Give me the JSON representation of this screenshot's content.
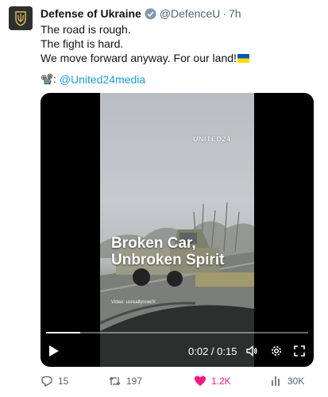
{
  "tweet": {
    "author_name": "Defense of Ukraine",
    "handle": "@DefenceU",
    "separator": "·",
    "time": "7h",
    "lines": [
      "The road is rough.",
      "The fight is hard.",
      "We move forward anyway. For our land!"
    ],
    "credit_emoji": "📽️:",
    "credit_link": "@United24media"
  },
  "media": {
    "watermark": "UNITED24",
    "headline": [
      "Broken Car,",
      "Unbroken Spirit"
    ],
    "video_credit": "Video: usreallynow/X",
    "timecode": "0:02 / 0:15",
    "progress_fraction": 0.13
  },
  "actions": {
    "replies": "15",
    "reposts": "197",
    "likes": "1.2K",
    "views": "30K"
  },
  "colors": {
    "accent": "#1d9bf0",
    "like": "#f91880",
    "muted": "#536471"
  }
}
